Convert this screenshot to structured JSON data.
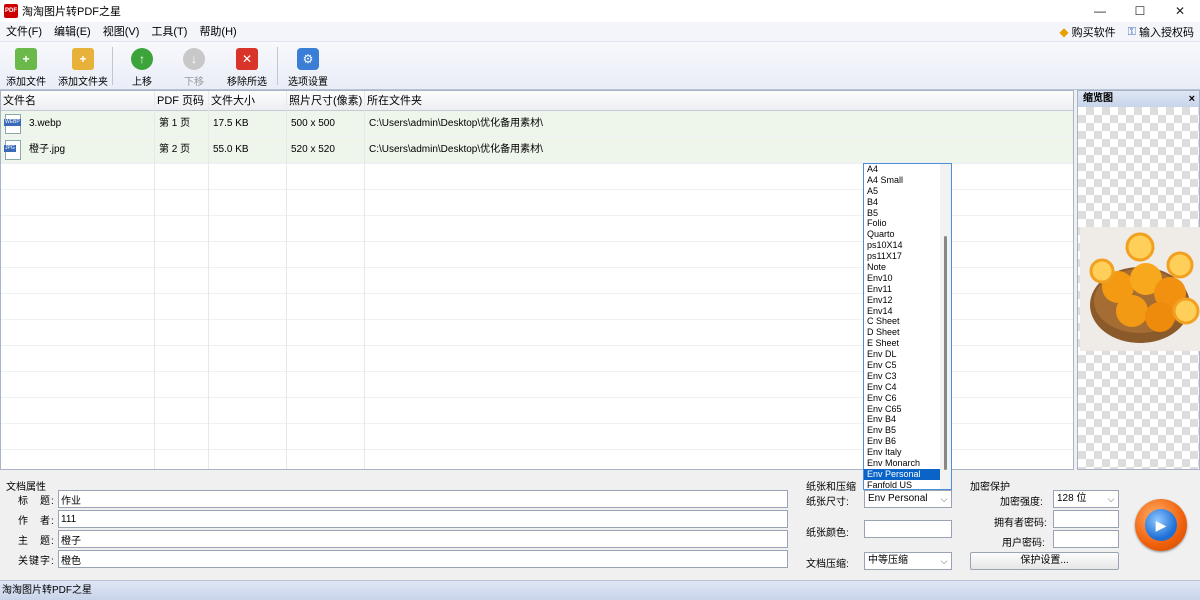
{
  "window": {
    "title": "淘淘图片转PDF之星",
    "icon": "PDF"
  },
  "menu": {
    "items": [
      "文件(F)",
      "编辑(E)",
      "视图(V)",
      "工具(T)",
      "帮助(H)"
    ],
    "buy": "购买软件",
    "license": "输入授权码"
  },
  "toolbar": {
    "add_file": "添加文件",
    "add_folder": "添加文件夹",
    "move_up": "上移",
    "move_down": "下移",
    "remove_selected": "移除所选",
    "options": "选项设置"
  },
  "file_list": {
    "columns": [
      "文件名",
      "PDF 页码",
      "文件大小",
      "照片尺寸(像素)",
      "所在文件夹"
    ],
    "rows": [
      {
        "type": "WEBP",
        "name": "3.webp",
        "page": "第 1 页",
        "size": "17.5 KB",
        "dims": "500 x 500",
        "folder": "C:\\Users\\admin\\Desktop\\优化备用素材\\"
      },
      {
        "type": "JPG",
        "name": "橙子.jpg",
        "page": "第 2 页",
        "size": "55.0 KB",
        "dims": "520 x 520",
        "folder": "C:\\Users\\admin\\Desktop\\优化备用素材\\"
      }
    ]
  },
  "preview": {
    "title": "缩览图",
    "close": "×"
  },
  "doc_props": {
    "group": "文档属性",
    "title_label": "标　题:",
    "title_value": "作业",
    "author_label": "作　者:",
    "author_value": "111",
    "subject_label": "主　题:",
    "subject_value": "橙子",
    "keywords_label": "关键字:",
    "keywords_value": "橙色"
  },
  "paper": {
    "group": "纸张和压缩",
    "size_label": "纸张尺寸:",
    "size_value": "Env Personal",
    "color_label": "纸张颜色:",
    "compress_label": "文档压缩:",
    "compress_value": "中等压缩"
  },
  "encrypt": {
    "group": "加密保护",
    "strength_label": "加密强度:",
    "strength_value": "128 位",
    "owner_label": "拥有者密码:",
    "user_label": "用户密码:",
    "settings_button": "保护设置..."
  },
  "dropdown": {
    "options": [
      "A4",
      "A4 Small",
      "A5",
      "B4",
      "B5",
      "Folio",
      "Quarto",
      "ps10X14",
      "ps11X17",
      "Note",
      "Env10",
      "Env11",
      "Env12",
      "Env14",
      "C Sheet",
      "D Sheet",
      "E Sheet",
      "Env DL",
      "Env C5",
      "Env C3",
      "Env C4",
      "Env C6",
      "Env C65",
      "Env B4",
      "Env B5",
      "Env B6",
      "Env Italy",
      "Env Monarch",
      "Env Personal",
      "Fanfold US"
    ],
    "selected": "Env Personal"
  },
  "status": {
    "text": "淘淘图片转PDF之星"
  }
}
